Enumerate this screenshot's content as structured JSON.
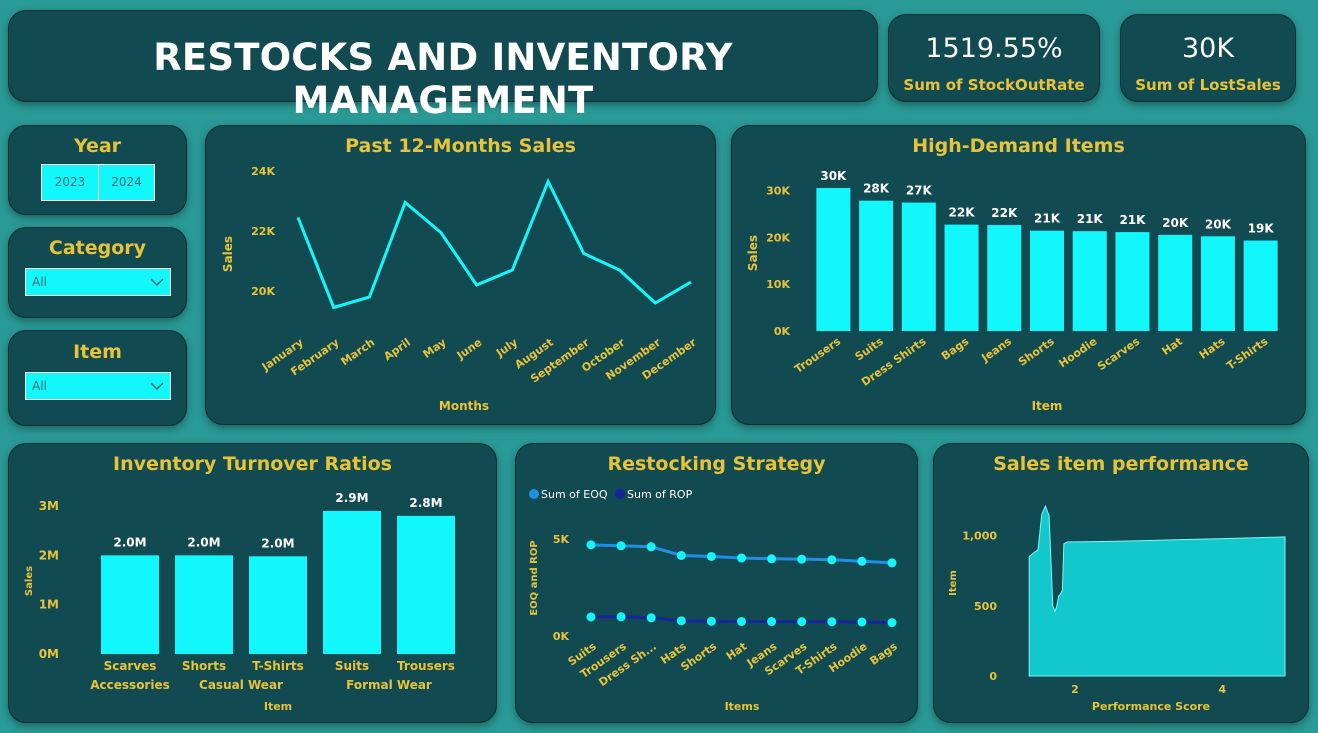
{
  "header": {
    "title": "RESTOCKS AND INVENTORY MANAGEMENT"
  },
  "kpis": [
    {
      "value": "1519.55%",
      "label": "Sum of StockOutRate"
    },
    {
      "value": "30K",
      "label": "Sum of LostSales"
    }
  ],
  "slicers": {
    "year": {
      "title": "Year",
      "options": [
        "2023",
        "2024"
      ]
    },
    "category": {
      "title": "Category",
      "value": "All"
    },
    "item": {
      "title": "Item",
      "value": "All"
    }
  },
  "colors": {
    "bar": "#12f7fb",
    "eoq": "#1f8ee6",
    "rop": "#17249c",
    "accent": "#e8c33a",
    "panel": "#124a52",
    "background": "#2a9a96"
  },
  "charts": {
    "monthly": {
      "title": "Past 12-Months Sales",
      "chart_data": {
        "type": "line",
        "xlabel": "Months",
        "ylabel": "Sales",
        "categories": [
          "January",
          "February",
          "March",
          "April",
          "May",
          "June",
          "July",
          "August",
          "September",
          "October",
          "November",
          "December"
        ],
        "values": [
          22450,
          19450,
          19800,
          22950,
          21950,
          20200,
          20700,
          23650,
          21250,
          20700,
          19600,
          20300
        ],
        "yticks": [
          {
            "v": 20000,
            "label": "20K"
          },
          {
            "v": 22000,
            "label": "22K"
          },
          {
            "v": 24000,
            "label": "24K"
          }
        ],
        "ylim": [
          19000,
          24000
        ]
      }
    },
    "demand": {
      "title": "High-Demand Items",
      "chart_data": {
        "type": "bar",
        "xlabel": "Item",
        "ylabel": "Sales",
        "categories": [
          "Trousers",
          "Suits",
          "Dress Shirts",
          "Bags",
          "Jeans",
          "Shorts",
          "Hoodie",
          "Scarves",
          "Hat",
          "Hats",
          "T-Shirts"
        ],
        "values": [
          30500,
          27800,
          27400,
          22700,
          22600,
          21400,
          21300,
          21100,
          20500,
          20200,
          19300
        ],
        "labels": [
          "30K",
          "28K",
          "27K",
          "22K",
          "22K",
          "21K",
          "21K",
          "21K",
          "20K",
          "20K",
          "19K"
        ],
        "yticks": [
          {
            "v": 0,
            "label": "0K"
          },
          {
            "v": 10000,
            "label": "10K"
          },
          {
            "v": 20000,
            "label": "20K"
          },
          {
            "v": 30000,
            "label": "30K"
          }
        ],
        "ylim": [
          0,
          32000
        ]
      }
    },
    "turnover": {
      "title": "Inventory Turnover Ratios",
      "chart_data": {
        "type": "bar",
        "xlabel": "Item",
        "ylabel": "Sales",
        "categories": [
          "Scarves",
          "Shorts",
          "T-Shirts",
          "Suits",
          "Trousers"
        ],
        "groups": [
          {
            "name": "Accessories",
            "span": [
              0,
              0
            ]
          },
          {
            "name": "Casual Wear",
            "span": [
              1,
              2
            ]
          },
          {
            "name": "Formal Wear",
            "span": [
              3,
              4
            ]
          }
        ],
        "values": [
          2000000,
          2000000,
          1980000,
          2900000,
          2800000
        ],
        "labels": [
          "2.0M",
          "2.0M",
          "2.0M",
          "2.9M",
          "2.8M"
        ],
        "yticks": [
          {
            "v": 0,
            "label": "0M"
          },
          {
            "v": 1000000,
            "label": "1M"
          },
          {
            "v": 2000000,
            "label": "2M"
          },
          {
            "v": 3000000,
            "label": "3M"
          }
        ],
        "ylim": [
          0,
          3000000
        ]
      }
    },
    "restock": {
      "title": "Restocking Strategy",
      "chart_data": {
        "type": "line",
        "xlabel": "Items",
        "ylabel": "EOQ and ROP",
        "categories": [
          "Suits",
          "Trousers",
          "Dress Sh...",
          "Hats",
          "Shorts",
          "Hat",
          "Jeans",
          "Scarves",
          "T-Shirts",
          "Hoodie",
          "Bags"
        ],
        "series": [
          {
            "name": "Sum of EOQ",
            "values": [
              4700,
              4650,
              4600,
              4150,
              4100,
              4020,
              3980,
              3960,
              3930,
              3850,
              3770
            ]
          },
          {
            "name": "Sum of ROP",
            "values": [
              980,
              990,
              940,
              780,
              760,
              750,
              745,
              740,
              735,
              720,
              690
            ]
          }
        ],
        "yticks": [
          {
            "v": 0,
            "label": "0K"
          },
          {
            "v": 5000,
            "label": "5K"
          }
        ],
        "ylim": [
          0,
          5000
        ],
        "legend_position": "top-left"
      }
    },
    "performance": {
      "title": "Sales item performance",
      "chart_data": {
        "type": "area",
        "xlabel": "Performance Score",
        "ylabel": "Item",
        "x": [
          1.38,
          1.45,
          1.5,
          1.55,
          1.6,
          1.65,
          1.7,
          1.73,
          1.75,
          1.78,
          1.8,
          1.83,
          1.85,
          1.88,
          1.9,
          2.0,
          2.5,
          3.0,
          3.5,
          4.0,
          4.5,
          4.85
        ],
        "y": [
          850,
          880,
          900,
          1150,
          1210,
          1140,
          500,
          460,
          490,
          570,
          580,
          610,
          940,
          950,
          955,
          955,
          958,
          965,
          972,
          978,
          985,
          990
        ],
        "xticks": [
          {
            "v": 2,
            "label": "2"
          },
          {
            "v": 4,
            "label": "4"
          }
        ],
        "yticks": [
          {
            "v": 0,
            "label": "0"
          },
          {
            "v": 500,
            "label": "500"
          },
          {
            "v": 1000,
            "label": "1,000"
          }
        ],
        "xlim": [
          1.35,
          4.85
        ],
        "ylim": [
          0,
          1260
        ]
      }
    }
  }
}
